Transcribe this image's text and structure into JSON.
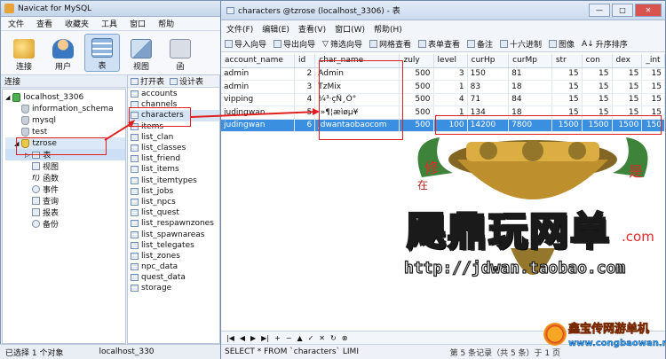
{
  "main": {
    "title": "Navicat for MySQL",
    "menu": [
      "文件",
      "查看",
      "收藏夹",
      "工具",
      "窗口",
      "帮助"
    ],
    "toolbar": [
      {
        "label": "连接",
        "icon": "connection-icon"
      },
      {
        "label": "用户",
        "icon": "user-icon"
      },
      {
        "label": "表",
        "icon": "table-icon"
      },
      {
        "label": "视图",
        "icon": "view-icon"
      },
      {
        "label": "函",
        "icon": "function-icon"
      }
    ],
    "section": "连接",
    "tree": {
      "connection": "localhost_3306",
      "databases": [
        "information_schema",
        "mysql",
        "test"
      ],
      "open_db": "tzrose",
      "children": [
        "表",
        "视图",
        "函数",
        "事件",
        "查询",
        "报表",
        "备份"
      ]
    },
    "objects_toolbar": {
      "open": "打开表",
      "design": "设计表"
    },
    "tables": [
      "accounts",
      "channels",
      "characters",
      "items",
      "list_clan",
      "list_classes",
      "list_friend",
      "list_items",
      "list_itemtypes",
      "list_jobs",
      "list_npcs",
      "list_quest",
      "list_respawnzones",
      "list_spawnareas",
      "list_telegates",
      "list_zones",
      "npc_data",
      "quest_data",
      "storage"
    ],
    "status": {
      "selected": "已选择 1 个对象",
      "connection": "localhost_330"
    }
  },
  "table_window": {
    "title": "characters @tzrose (localhost_3306) - 表",
    "menu": [
      "文件(F)",
      "编辑(E)",
      "查看(V)",
      "窗口(W)",
      "帮助(H)"
    ],
    "toolbar": [
      "导入向导",
      "导出向导",
      "筛选向导",
      "网格查看",
      "表单查看",
      "备注",
      "十六进制",
      "图像",
      "升序排序"
    ],
    "columns": [
      "account_name",
      "id",
      "char_name",
      "zuly",
      "level",
      "curHp",
      "curMp",
      "str",
      "con",
      "dex",
      "_int"
    ],
    "rows": [
      [
        "admin",
        "2",
        "Admin",
        "500",
        "3",
        "150",
        "81",
        "15",
        "15",
        "15",
        "15"
      ],
      [
        "admin",
        "3",
        "TzMix",
        "500",
        "1",
        "83",
        "18",
        "15",
        "15",
        "15",
        "15"
      ],
      [
        "vipping",
        "4",
        "¼³·çÑ¸Ó°",
        "500",
        "4",
        "71",
        "84",
        "15",
        "15",
        "15",
        "15"
      ],
      [
        "judingwan",
        "5",
        "i»¶¦æìøµ¥",
        "500",
        "1",
        "134",
        "18",
        "15",
        "15",
        "15",
        "15"
      ],
      [
        "judingwan",
        "6",
        "jdwantaobaocom",
        "500",
        "100",
        "14200",
        "7800",
        "1500",
        "1500",
        "1500",
        "150"
      ]
    ],
    "selected_row": 4,
    "nav_buttons": [
      "first",
      "prev",
      "next",
      "last",
      "add",
      "delete",
      "up",
      "save",
      "cancel",
      "refresh",
      "stop"
    ],
    "sql": "SELECT * FROM `characters` LIMI",
    "page_info": "第 5 条记录（共 5 条）于 1 页"
  },
  "watermark": {
    "brand": "飓鼎玩网单",
    "suffix": ".com",
    "url": "http://jdwan.taobao.com",
    "partial_text_left": "修",
    "partial_text_right": "是",
    "partial_text_mid": "在",
    "footer_logo": "鑫宝传网游单机",
    "footer_url": "www.congbaowan.net"
  },
  "colors": {
    "selection": "#3b8fe0",
    "highlight": "#e02020",
    "accent": "#1f5fa8"
  }
}
